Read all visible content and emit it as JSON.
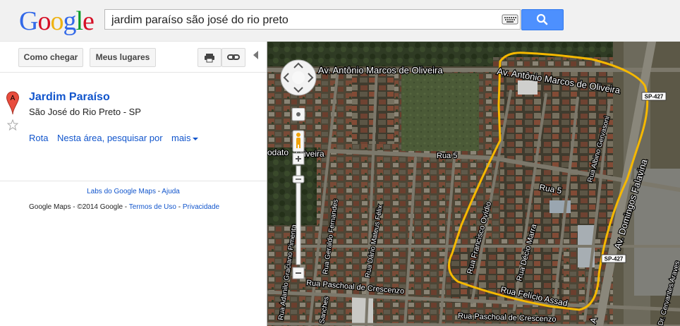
{
  "logo": {
    "letters": [
      "G",
      "o",
      "o",
      "g",
      "l",
      "e"
    ]
  },
  "search": {
    "query": "jardim paraíso são josé do rio preto"
  },
  "panel": {
    "directions_label": "Como chegar",
    "my_places_label": "Meus lugares",
    "place": {
      "marker_letter": "A",
      "name": "Jardim Paraíso",
      "address": "São José do Rio Preto - SP"
    },
    "actions": {
      "route": "Rota",
      "nearby": "Nesta área, pesquisar por",
      "more": "mais"
    },
    "footer": {
      "labs": "Labs do Google Maps",
      "sep1": " - ",
      "help": "Ajuda",
      "maps": "Google Maps",
      "copyright": " - ©2014 Google - ",
      "terms": "Termos de Uso",
      "sep2": " - ",
      "privacy": "Privacidade"
    }
  },
  "map": {
    "labels": {
      "av_antonio_left": "Av. Antônio Marcos de Oliveira",
      "av_antonio_right": "Av. Antônio Marcos de Oliveira",
      "av_domingos": "Av. Domingos Falavina",
      "sp427_top": "SP-427",
      "sp427_bottom": "SP-427",
      "rua_5_left": "Rua 5",
      "rua_5_right": "Rua 5",
      "oliveira_left": "odato",
      "oliveira_right": "Oliveira",
      "rua_albino": "Rua Albino Gervasoni",
      "rua_francisco": "Rua Francisco Ovídio",
      "rua_decio": "Rua Décio Marra",
      "rua_felicio": "Rua Felício Assad",
      "rua_adanilo": "Rua Adanilo Graciano Pimenta",
      "rua_dario": "Rua Dário Mateus Félix",
      "rua_geraldo": "Rua Geraldo Fernandes",
      "rua_paschoal_1": "Rua Paschoal de Crescenzo",
      "rua_paschoal_2": "Rua Paschoal de Crescenzo",
      "rua_sanches": "Sanches",
      "rua_cervantes": "Dr. Cervantes Araves",
      "av_short": "A"
    },
    "boundary_color": "#f5b800"
  }
}
